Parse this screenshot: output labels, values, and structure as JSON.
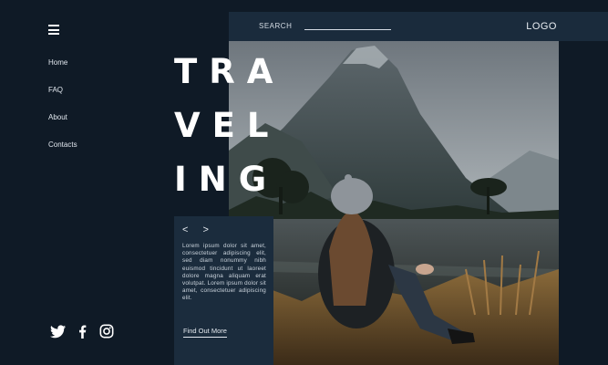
{
  "header": {
    "search_label": "SEARCH",
    "logo": "LOGO"
  },
  "menu": {
    "icon": "hamburger-menu-icon"
  },
  "nav": {
    "items": [
      {
        "label": "Home"
      },
      {
        "label": "FAQ"
      },
      {
        "label": "About"
      },
      {
        "label": "Contacts"
      }
    ]
  },
  "hero": {
    "title_lines": [
      "TRA",
      "VEL",
      "ING"
    ]
  },
  "card": {
    "prev_icon": "chevron-left-icon",
    "next_icon": "chevron-right-icon",
    "prev_glyph": "<",
    "next_glyph": ">",
    "body": "Lorem ipsum dolor sit amet, consectetuer adipiscing elit, sed diam nonummy nibh euismod tincidunt ut laoreet dolore magna aliquam erat volutpat. Lorem ipsum dolor sit amet, consectetuer adipiscing elit.",
    "cta": "Find Out More"
  },
  "social": {
    "icons": [
      "twitter-icon",
      "facebook-icon",
      "instagram-icon"
    ]
  },
  "colors": {
    "background": "#0f1a26",
    "panel": "#1b2c3d",
    "text": "#ffffff"
  }
}
